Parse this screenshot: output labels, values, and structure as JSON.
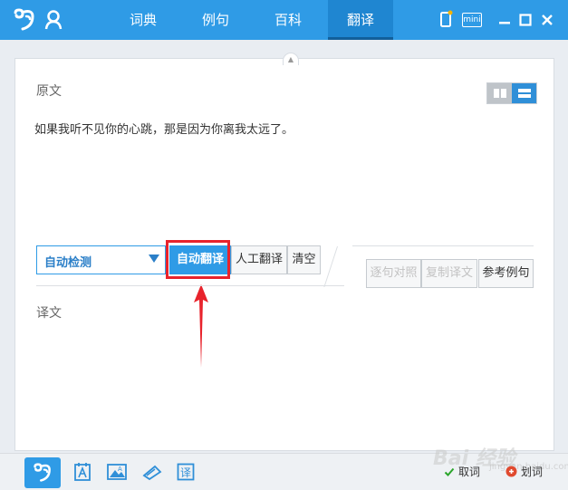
{
  "nav": {
    "tabs": [
      {
        "label": "词典"
      },
      {
        "label": "例句"
      },
      {
        "label": "百科"
      },
      {
        "label": "翻译"
      }
    ],
    "mini_label": "mini"
  },
  "main": {
    "source_label": "原文",
    "source_text": "如果我听不见你的心跳，那是因为你离我太远了。",
    "target_label": "译文",
    "language_select": "自动检测",
    "buttons": {
      "auto_translate": "自动翻译",
      "human_translate": "人工翻译",
      "clear": "清空",
      "sentence_compare": "逐句对照",
      "copy_translation": "复制译文",
      "reference_examples": "参考例句"
    }
  },
  "bottombar": {
    "fetch_word": "取词",
    "select_word": "划词"
  },
  "watermark": {
    "text": "Bai 经验",
    "sub": "jingyan.baidu.com"
  },
  "colors": {
    "titlebar": "#2f9be6",
    "active_tab": "#1f86d1",
    "highlight": "#e8232c"
  }
}
